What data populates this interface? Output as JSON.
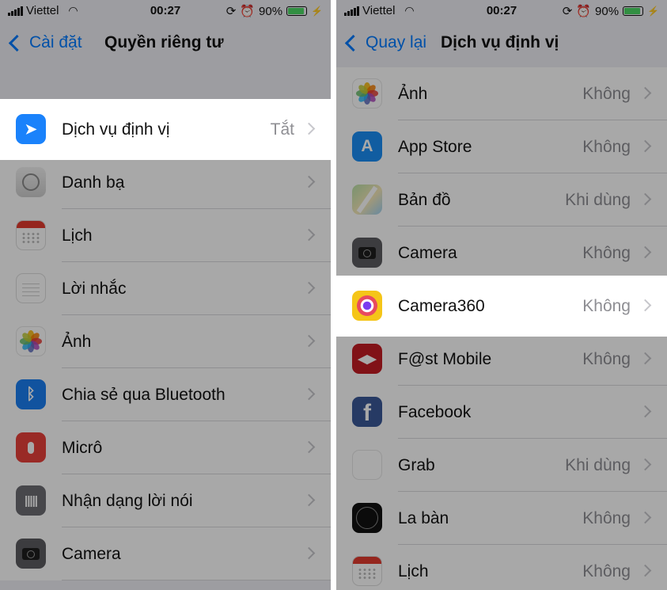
{
  "status_left": {
    "carrier": "Viettel",
    "time": "00:27",
    "battery": "90%",
    "battery_level": 0.9
  },
  "status_right": {
    "carrier": "Viettel",
    "time": "00:27",
    "battery": "90%",
    "battery_level": 0.9
  },
  "left": {
    "back_label": "Cài đặt",
    "title": "Quyền riêng tư",
    "rows": [
      {
        "icon": "location-arrow-icon",
        "label": "Dịch vụ định vị",
        "value": "Tắt",
        "highlighted": true
      },
      {
        "icon": "contacts-icon",
        "label": "Danh bạ",
        "value": ""
      },
      {
        "icon": "calendar-icon",
        "label": "Lịch",
        "value": ""
      },
      {
        "icon": "reminders-icon",
        "label": "Lời nhắc",
        "value": ""
      },
      {
        "icon": "photos-icon",
        "label": "Ảnh",
        "value": ""
      },
      {
        "icon": "bluetooth-icon",
        "label": "Chia sẻ qua Bluetooth",
        "value": ""
      },
      {
        "icon": "microphone-icon",
        "label": "Micrô",
        "value": ""
      },
      {
        "icon": "speech-recognition-icon",
        "label": "Nhận dạng lời nói",
        "value": ""
      },
      {
        "icon": "camera-icon",
        "label": "Camera",
        "value": ""
      }
    ]
  },
  "right": {
    "back_label": "Quay lại",
    "title": "Dịch vụ định vị",
    "rows": [
      {
        "icon": "photos-icon",
        "label": "Ảnh",
        "value": "Không"
      },
      {
        "icon": "app-store-icon",
        "label": "App Store",
        "value": "Không"
      },
      {
        "icon": "maps-icon",
        "label": "Bản đồ",
        "value": "Khi dùng"
      },
      {
        "icon": "camera-icon",
        "label": "Camera",
        "value": "Không"
      },
      {
        "icon": "camera360-icon",
        "label": "Camera360",
        "value": "Không",
        "highlighted": true
      },
      {
        "icon": "fast-mobile-icon",
        "label": "F@st Mobile",
        "value": "Không"
      },
      {
        "icon": "facebook-icon",
        "label": "Facebook",
        "value": ""
      },
      {
        "icon": "grab-icon",
        "label": "Grab",
        "value": "Khi dùng"
      },
      {
        "icon": "compass-icon",
        "label": "La bàn",
        "value": "Không"
      },
      {
        "icon": "calendar-icon",
        "label": "Lịch",
        "value": "Không"
      }
    ]
  },
  "icon_glyphs": {
    "bluetooth": "ᛒ",
    "app_store": "A",
    "fast_mobile": "◀▶",
    "facebook": "f",
    "grab": "Grab",
    "speech": "|||||",
    "location": "➤"
  },
  "colors": {
    "ios_blue": "#007aff",
    "background": "#efeff4",
    "chevron": "#c7c7cc",
    "value_gray": "#8e8e93",
    "battery_green": "#4cd964"
  }
}
